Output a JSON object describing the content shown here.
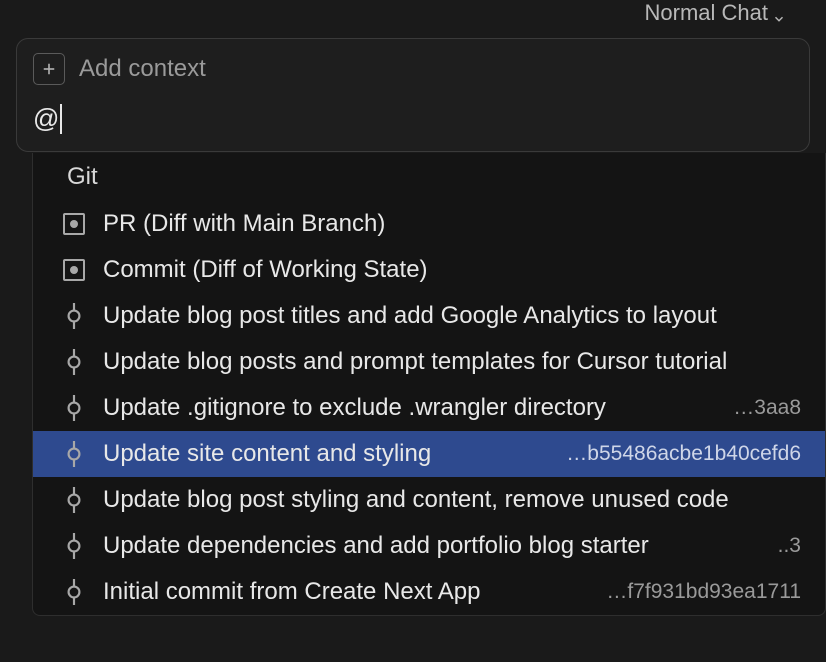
{
  "mode": {
    "label": "Normal Chat"
  },
  "context": {
    "placeholder": "Add context",
    "input_value": "@"
  },
  "dropdown": {
    "header": "Git",
    "items": [
      {
        "icon": "square-dot",
        "label": "PR (Diff with Main Branch)",
        "hash": ""
      },
      {
        "icon": "square-dot",
        "label": "Commit (Diff of Working State)",
        "hash": ""
      },
      {
        "icon": "commit",
        "label": "Update blog post titles and add Google Analytics to layout",
        "hash": ""
      },
      {
        "icon": "commit",
        "label": "Update blog posts and prompt templates for Cursor tutorial",
        "hash": ""
      },
      {
        "icon": "commit",
        "label": "Update .gitignore to exclude .wrangler directory",
        "hash": "…3aa8"
      },
      {
        "icon": "commit",
        "label": "Update site content and styling",
        "hash": "…b55486acbe1b40cefd6",
        "selected": true
      },
      {
        "icon": "commit",
        "label": "Update blog post styling and content, remove unused code",
        "hash": ""
      },
      {
        "icon": "commit",
        "label": "Update dependencies and add portfolio blog starter",
        "hash": "..3"
      },
      {
        "icon": "commit",
        "label": "Initial commit from Create Next App",
        "hash": "…f7f931bd93ea1711"
      }
    ]
  }
}
